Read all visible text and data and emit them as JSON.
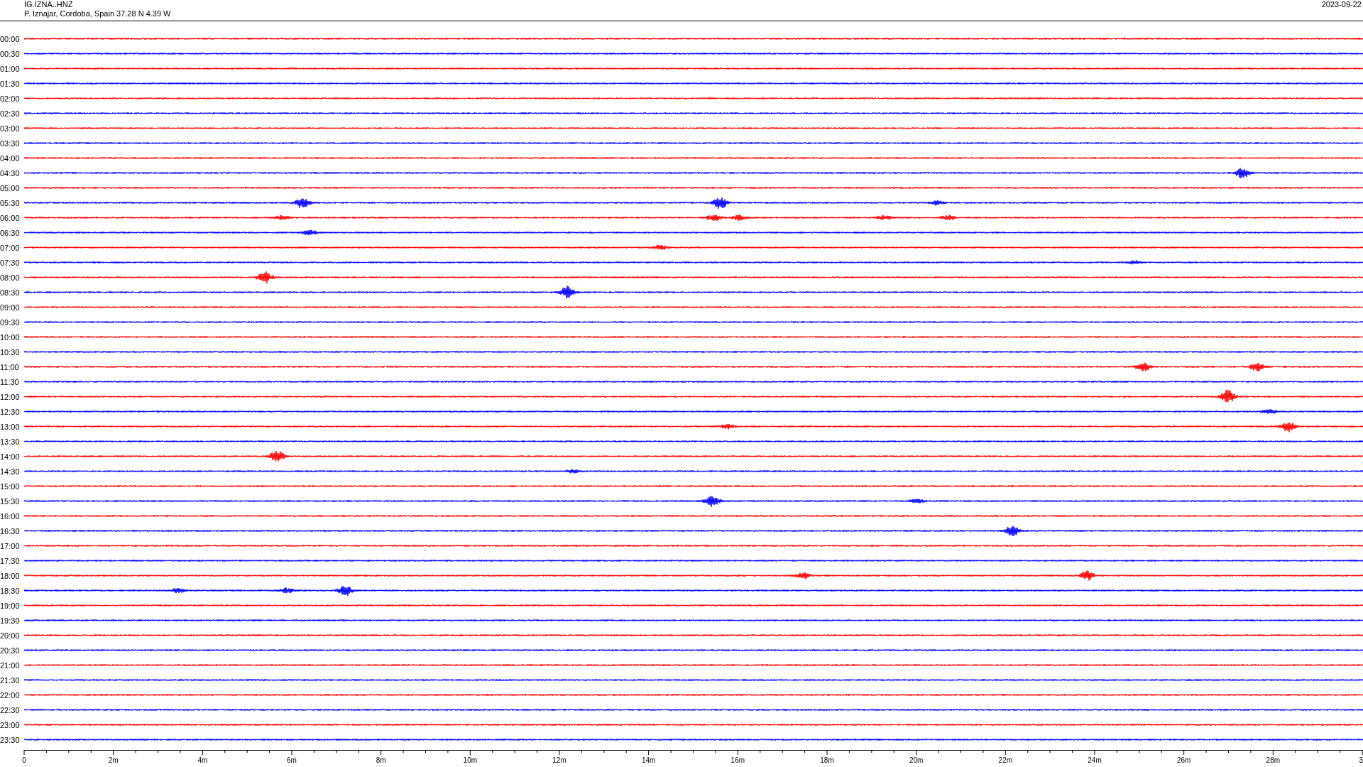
{
  "header": {
    "station": "IG.IZNA..HNZ",
    "location": "P. Iznajar, Cordoba, Spain  37.28 N 4.39 W",
    "date": "2023-09-22"
  },
  "traces": [
    {
      "label": "00:00",
      "color": "#ff0000"
    },
    {
      "label": "00:30",
      "color": "#0000ff"
    },
    {
      "label": "01:00",
      "color": "#ff0000"
    },
    {
      "label": "01:30",
      "color": "#0000ff"
    },
    {
      "label": "02:00",
      "color": "#ff0000"
    },
    {
      "label": "02:30",
      "color": "#0000ff"
    },
    {
      "label": "03:00",
      "color": "#ff0000"
    },
    {
      "label": "03:30",
      "color": "#0000ff"
    },
    {
      "label": "04:00",
      "color": "#ff0000"
    },
    {
      "label": "04:30",
      "color": "#0000ff"
    },
    {
      "label": "05:00",
      "color": "#ff0000"
    },
    {
      "label": "05:30",
      "color": "#0000ff"
    },
    {
      "label": "06:00",
      "color": "#ff0000"
    },
    {
      "label": "06:30",
      "color": "#0000ff"
    },
    {
      "label": "07:00",
      "color": "#ff0000"
    },
    {
      "label": "07:30",
      "color": "#0000ff"
    },
    {
      "label": "08:00",
      "color": "#ff0000"
    },
    {
      "label": "08:30",
      "color": "#0000ff"
    },
    {
      "label": "09:00",
      "color": "#ff0000"
    },
    {
      "label": "09:30",
      "color": "#0000ff"
    },
    {
      "label": "10:00",
      "color": "#ff0000"
    },
    {
      "label": "10:30",
      "color": "#0000ff"
    },
    {
      "label": "11:00",
      "color": "#ff0000"
    },
    {
      "label": "11:30",
      "color": "#0000ff"
    },
    {
      "label": "12:00",
      "color": "#ff0000"
    },
    {
      "label": "12:30",
      "color": "#0000ff"
    },
    {
      "label": "13:00",
      "color": "#ff0000"
    },
    {
      "label": "13:30",
      "color": "#0000ff"
    },
    {
      "label": "14:00",
      "color": "#ff0000"
    },
    {
      "label": "14:30",
      "color": "#0000ff"
    },
    {
      "label": "15:00",
      "color": "#ff0000"
    },
    {
      "label": "15:30",
      "color": "#0000ff"
    },
    {
      "label": "16:00",
      "color": "#ff0000"
    },
    {
      "label": "16:30",
      "color": "#0000ff"
    },
    {
      "label": "17:00",
      "color": "#ff0000"
    },
    {
      "label": "17:30",
      "color": "#0000ff"
    },
    {
      "label": "18:00",
      "color": "#ff0000"
    },
    {
      "label": "18:30",
      "color": "#0000ff"
    },
    {
      "label": "19:00",
      "color": "#ff0000"
    },
    {
      "label": "19:30",
      "color": "#0000ff"
    },
    {
      "label": "20:00",
      "color": "#ff0000"
    },
    {
      "label": "20:30",
      "color": "#0000ff"
    },
    {
      "label": "21:00",
      "color": "#ff0000"
    },
    {
      "label": "21:30",
      "color": "#0000ff"
    },
    {
      "label": "22:00",
      "color": "#ff0000"
    },
    {
      "label": "22:30",
      "color": "#0000ff"
    },
    {
      "label": "23:00",
      "color": "#ff0000"
    },
    {
      "label": "23:30",
      "color": "#0000ff"
    }
  ],
  "x_axis": {
    "ticks": [
      "0",
      "2m",
      "4m",
      "6m",
      "8m",
      "10m",
      "12m",
      "14m",
      "16m",
      "18m",
      "20m",
      "22m",
      "24m",
      "26m",
      "28m",
      "3"
    ]
  }
}
